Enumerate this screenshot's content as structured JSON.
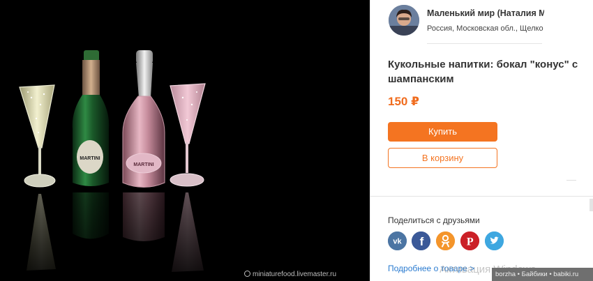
{
  "photo": {
    "alt": "Кукольные напитки: бокал \"конус\" с шампанским",
    "watermark": "miniaturefood.livemaster.ru",
    "bottle_left_label": "MARTINI",
    "bottle_right_label": "MARTINI"
  },
  "seller": {
    "name": "Маленький мир (Наталия М",
    "location": "Россия, Московская обл., Щелко"
  },
  "product": {
    "title": "Кукольные напитки: бокал \"конус\" с шампанским",
    "price": "150 ₽"
  },
  "actions": {
    "buy_label": "Купить",
    "cart_label": "В корзину"
  },
  "share": {
    "title": "Поделиться с друзьями",
    "networks": [
      {
        "name": "vk",
        "icon": "vk-icon",
        "color": "#4c75a3"
      },
      {
        "name": "facebook",
        "icon": "facebook-icon",
        "color": "#3b5998"
      },
      {
        "name": "odnoklassniki",
        "icon": "odnoklassniki-icon",
        "color": "#f4952b"
      },
      {
        "name": "pinterest",
        "icon": "pinterest-icon",
        "color": "#cb2027"
      },
      {
        "name": "twitter",
        "icon": "twitter-icon",
        "color": "#3ea7e0"
      }
    ]
  },
  "more_link": "Подробнее о товаре >",
  "overlay": {
    "activation": "Активация Windows",
    "credits": "borzha • Байбики • babiki.ru"
  },
  "colors": {
    "accent": "#f47421",
    "price": "#f06c1e",
    "link": "#2a7bd0"
  }
}
